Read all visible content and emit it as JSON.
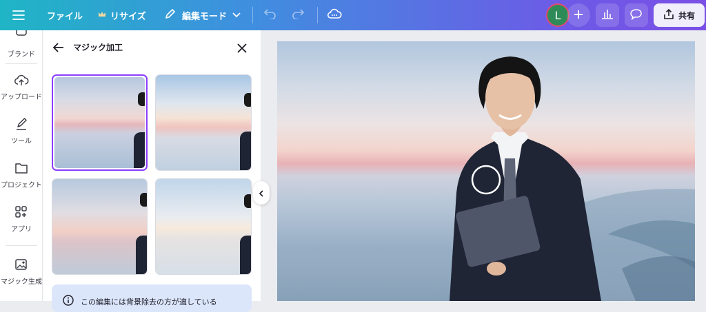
{
  "topbar": {
    "file_label": "ファイル",
    "resize_label": "リサイズ",
    "edit_mode_label": "編集モード",
    "avatar_initial": "L",
    "share_label": "共有"
  },
  "sidebar": {
    "items": [
      {
        "label": "ブランド",
        "icon": "brand-icon"
      },
      {
        "label": "アップロード",
        "icon": "upload-cloud-icon"
      },
      {
        "label": "ツール",
        "icon": "pen-tool-icon"
      },
      {
        "label": "プロジェクト",
        "icon": "folder-icon"
      },
      {
        "label": "アプリ",
        "icon": "apps-grid-icon"
      },
      {
        "label": "マジック生成",
        "icon": "magic-image-icon"
      }
    ]
  },
  "panel": {
    "title": "マジック加工",
    "notice_text": "この編集には背景除去の方が適している"
  },
  "colors": {
    "accent": "#8b3dff",
    "notice_bg": "#dce6fb",
    "avatar_bg": "#2e8b57"
  }
}
